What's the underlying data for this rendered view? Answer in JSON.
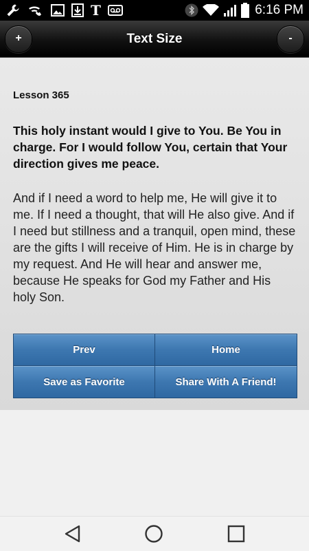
{
  "status_bar": {
    "time": "6:16 PM",
    "carrier_logo": "T",
    "left_icons": [
      "wrench-icon",
      "wifi-calling-icon",
      "image-icon",
      "download-icon",
      "t-mobile-icon",
      "voicemail-icon"
    ],
    "right_icons": [
      "bluetooth-icon",
      "wifi-icon",
      "signal-icon",
      "battery-icon"
    ]
  },
  "header": {
    "title": "Text Size",
    "increase_label": "+",
    "decrease_label": "-"
  },
  "lesson": {
    "label": "Lesson 365",
    "title": "This holy instant would I give to You. Be You in charge. For I would follow You, certain that Your direction gives me peace.",
    "body": "And if I need a word to help me, He will give it to me. If I need a thought, that will He also give. And if I need but stillness and a tranquil, open mind, these are the gifts I will receive of Him. He is in charge by my request. And He will hear and answer me, because He speaks for God my Father and His holy Son."
  },
  "buttons": {
    "prev": "Prev",
    "home": "Home",
    "save_favorite": "Save as Favorite",
    "share": "Share With A Friend!"
  },
  "colors": {
    "button_blue": "#3d77b0",
    "header_black": "#111111",
    "content_bg": "#e2e2e2"
  },
  "nav_bar": {
    "icons": [
      "back-icon",
      "home-circle-icon",
      "recents-icon"
    ]
  }
}
